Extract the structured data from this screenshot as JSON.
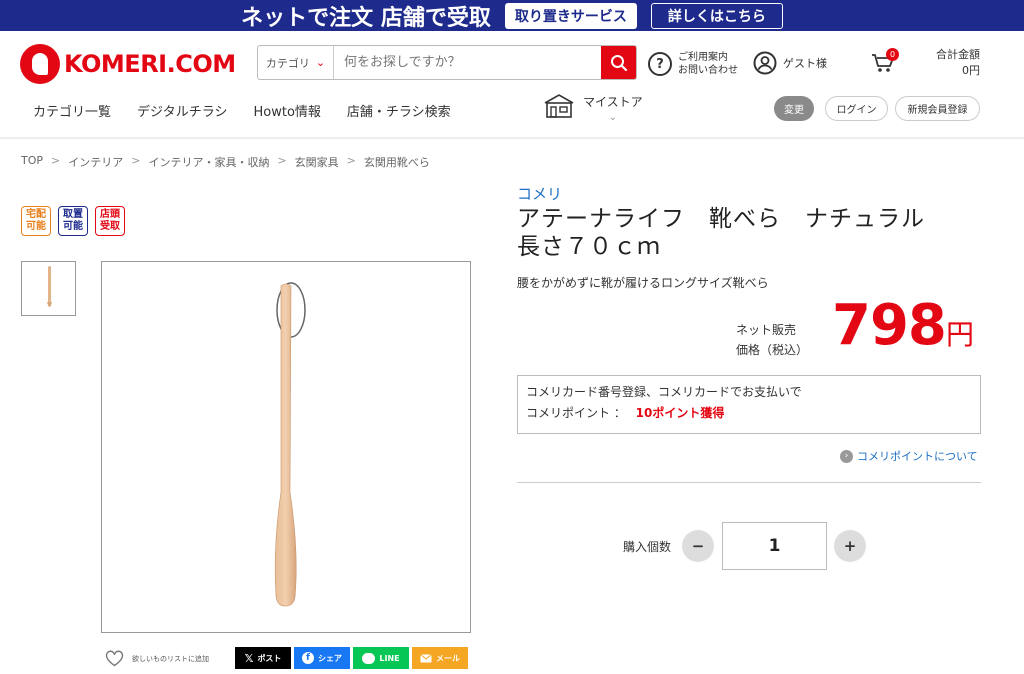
{
  "banner": {
    "text": "ネットで注文 店舗で受取",
    "button1": "取り置きサービス",
    "button2": "詳しくはこちら"
  },
  "logo": {
    "text": "KOMERI.COM"
  },
  "search": {
    "category": "カテゴリ",
    "placeholder": "何をお探しですか？"
  },
  "header": {
    "help_line1": "ご利用案内",
    "help_line2": "お問い合わせ",
    "guest": "ゲスト様",
    "cart_count": "0",
    "total_label": "合計金額",
    "total_value": "0円"
  },
  "nav": {
    "items": [
      "カテゴリ一覧",
      "デジタルチラシ",
      "Howto情報",
      "店舗・チラシ検索"
    ]
  },
  "mystore": {
    "label": "マイストア"
  },
  "buttons": {
    "change": "変更",
    "login": "ログイン",
    "register": "新規会員登録"
  },
  "breadcrumb": [
    "TOP",
    "インテリア",
    "インテリア・家具・収納",
    "玄関家具",
    "玄関用靴べら"
  ],
  "badges": [
    {
      "line1": "宅配",
      "line2": "可能",
      "color": "#e8801e"
    },
    {
      "line1": "取置",
      "line2": "可能",
      "color": "#1e2a8c"
    },
    {
      "line1": "店頭",
      "line2": "受取",
      "color": "#e30613"
    }
  ],
  "wishlist": {
    "label": "欲しいものリストに追加"
  },
  "share": [
    {
      "label": "ポスト",
      "color": "#000000",
      "icon": "x-icon"
    },
    {
      "label": "シェア",
      "color": "#1877f2",
      "icon": "facebook-icon"
    },
    {
      "label": "LINE",
      "color": "#06c755",
      "icon": "line-icon"
    },
    {
      "label": "メール",
      "color": "#f5a623",
      "icon": "mail-icon"
    }
  ],
  "product": {
    "brand": "コメリ",
    "title": "アテーナライフ　靴べら　ナチュラル　長さ７０ｃｍ",
    "subtitle": "腰をかがめずに靴が履けるロングサイズ靴べら",
    "price_label_line1": "ネット販売",
    "price_label_line2": "価格（税込）",
    "price": "798",
    "price_unit": "円"
  },
  "points": {
    "line1": "コメリカード番号登録、コメリカードでお支払いで",
    "line2_label": "コメリポイント ：",
    "line2_value": "10ポイント獲得",
    "link": "コメリポイントについて"
  },
  "quantity": {
    "label": "購入個数",
    "value": "1",
    "minus": "−",
    "plus": "+"
  }
}
